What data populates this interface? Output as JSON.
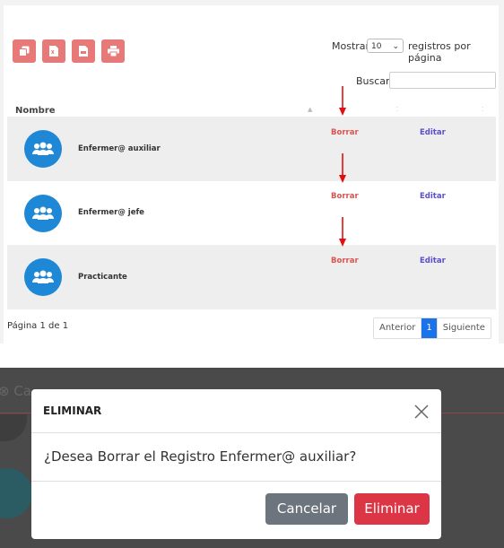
{
  "table": {
    "show_label": "Mostrar",
    "show_value": "10",
    "per_page_label": "registros por página",
    "search_label": "Buscar",
    "search_value": "",
    "column_name": "Nombre",
    "rows": [
      {
        "name": "Enfermer@ auxiliar",
        "delete": "Borrar",
        "edit": "Editar"
      },
      {
        "name": "Enfermer@ jefe",
        "delete": "Borrar",
        "edit": "Editar"
      },
      {
        "name": "Practicante",
        "delete": "Borrar",
        "edit": "Editar"
      }
    ],
    "page_info": "Página 1 de 1",
    "pager": {
      "prev": "Anterior",
      "current": "1",
      "next": "Siguiente"
    }
  },
  "toolbar": {
    "icons": [
      "copy-icon",
      "excel-file-icon",
      "pdf-file-icon",
      "print-icon"
    ],
    "color": "#e87979"
  },
  "modal": {
    "title": "ELIMINAR",
    "message": "¿Desea Borrar el Registro Enfermer@ auxiliar?",
    "cancel_label": "Cancelar",
    "delete_label": "Eliminar"
  },
  "colors": {
    "delete_link": "#d9534f",
    "edit_link": "#5a4fcf",
    "avatar": "#1e88d6",
    "pager_active": "#1a73e8",
    "cancel_button": "#6c757d",
    "delete_button": "#dc3545"
  }
}
